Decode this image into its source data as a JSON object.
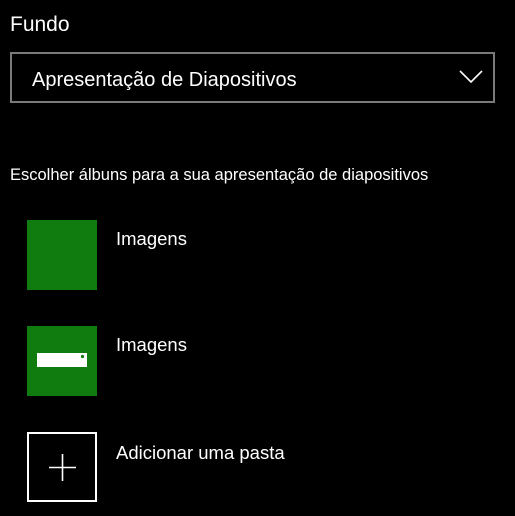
{
  "background_section": {
    "title": "Fundo",
    "dropdown": {
      "selected_value": "Apresentação de Diapositivos",
      "icon": "chevron-down-icon"
    }
  },
  "slideshow": {
    "albums_label": "Escolher álbuns para a sua apresentação de diapositivos",
    "albums": [
      {
        "label": "Imagens",
        "thumbnail": "solid-green"
      },
      {
        "label": "Imagens",
        "thumbnail": "green-with-image-glyph"
      }
    ],
    "add_folder": {
      "label": "Adicionar uma pasta",
      "icon": "plus-icon"
    }
  },
  "colors": {
    "background": "#000000",
    "text": "#ffffff",
    "accent": "#107c10",
    "dropdown_border": "#7a7a7a"
  }
}
